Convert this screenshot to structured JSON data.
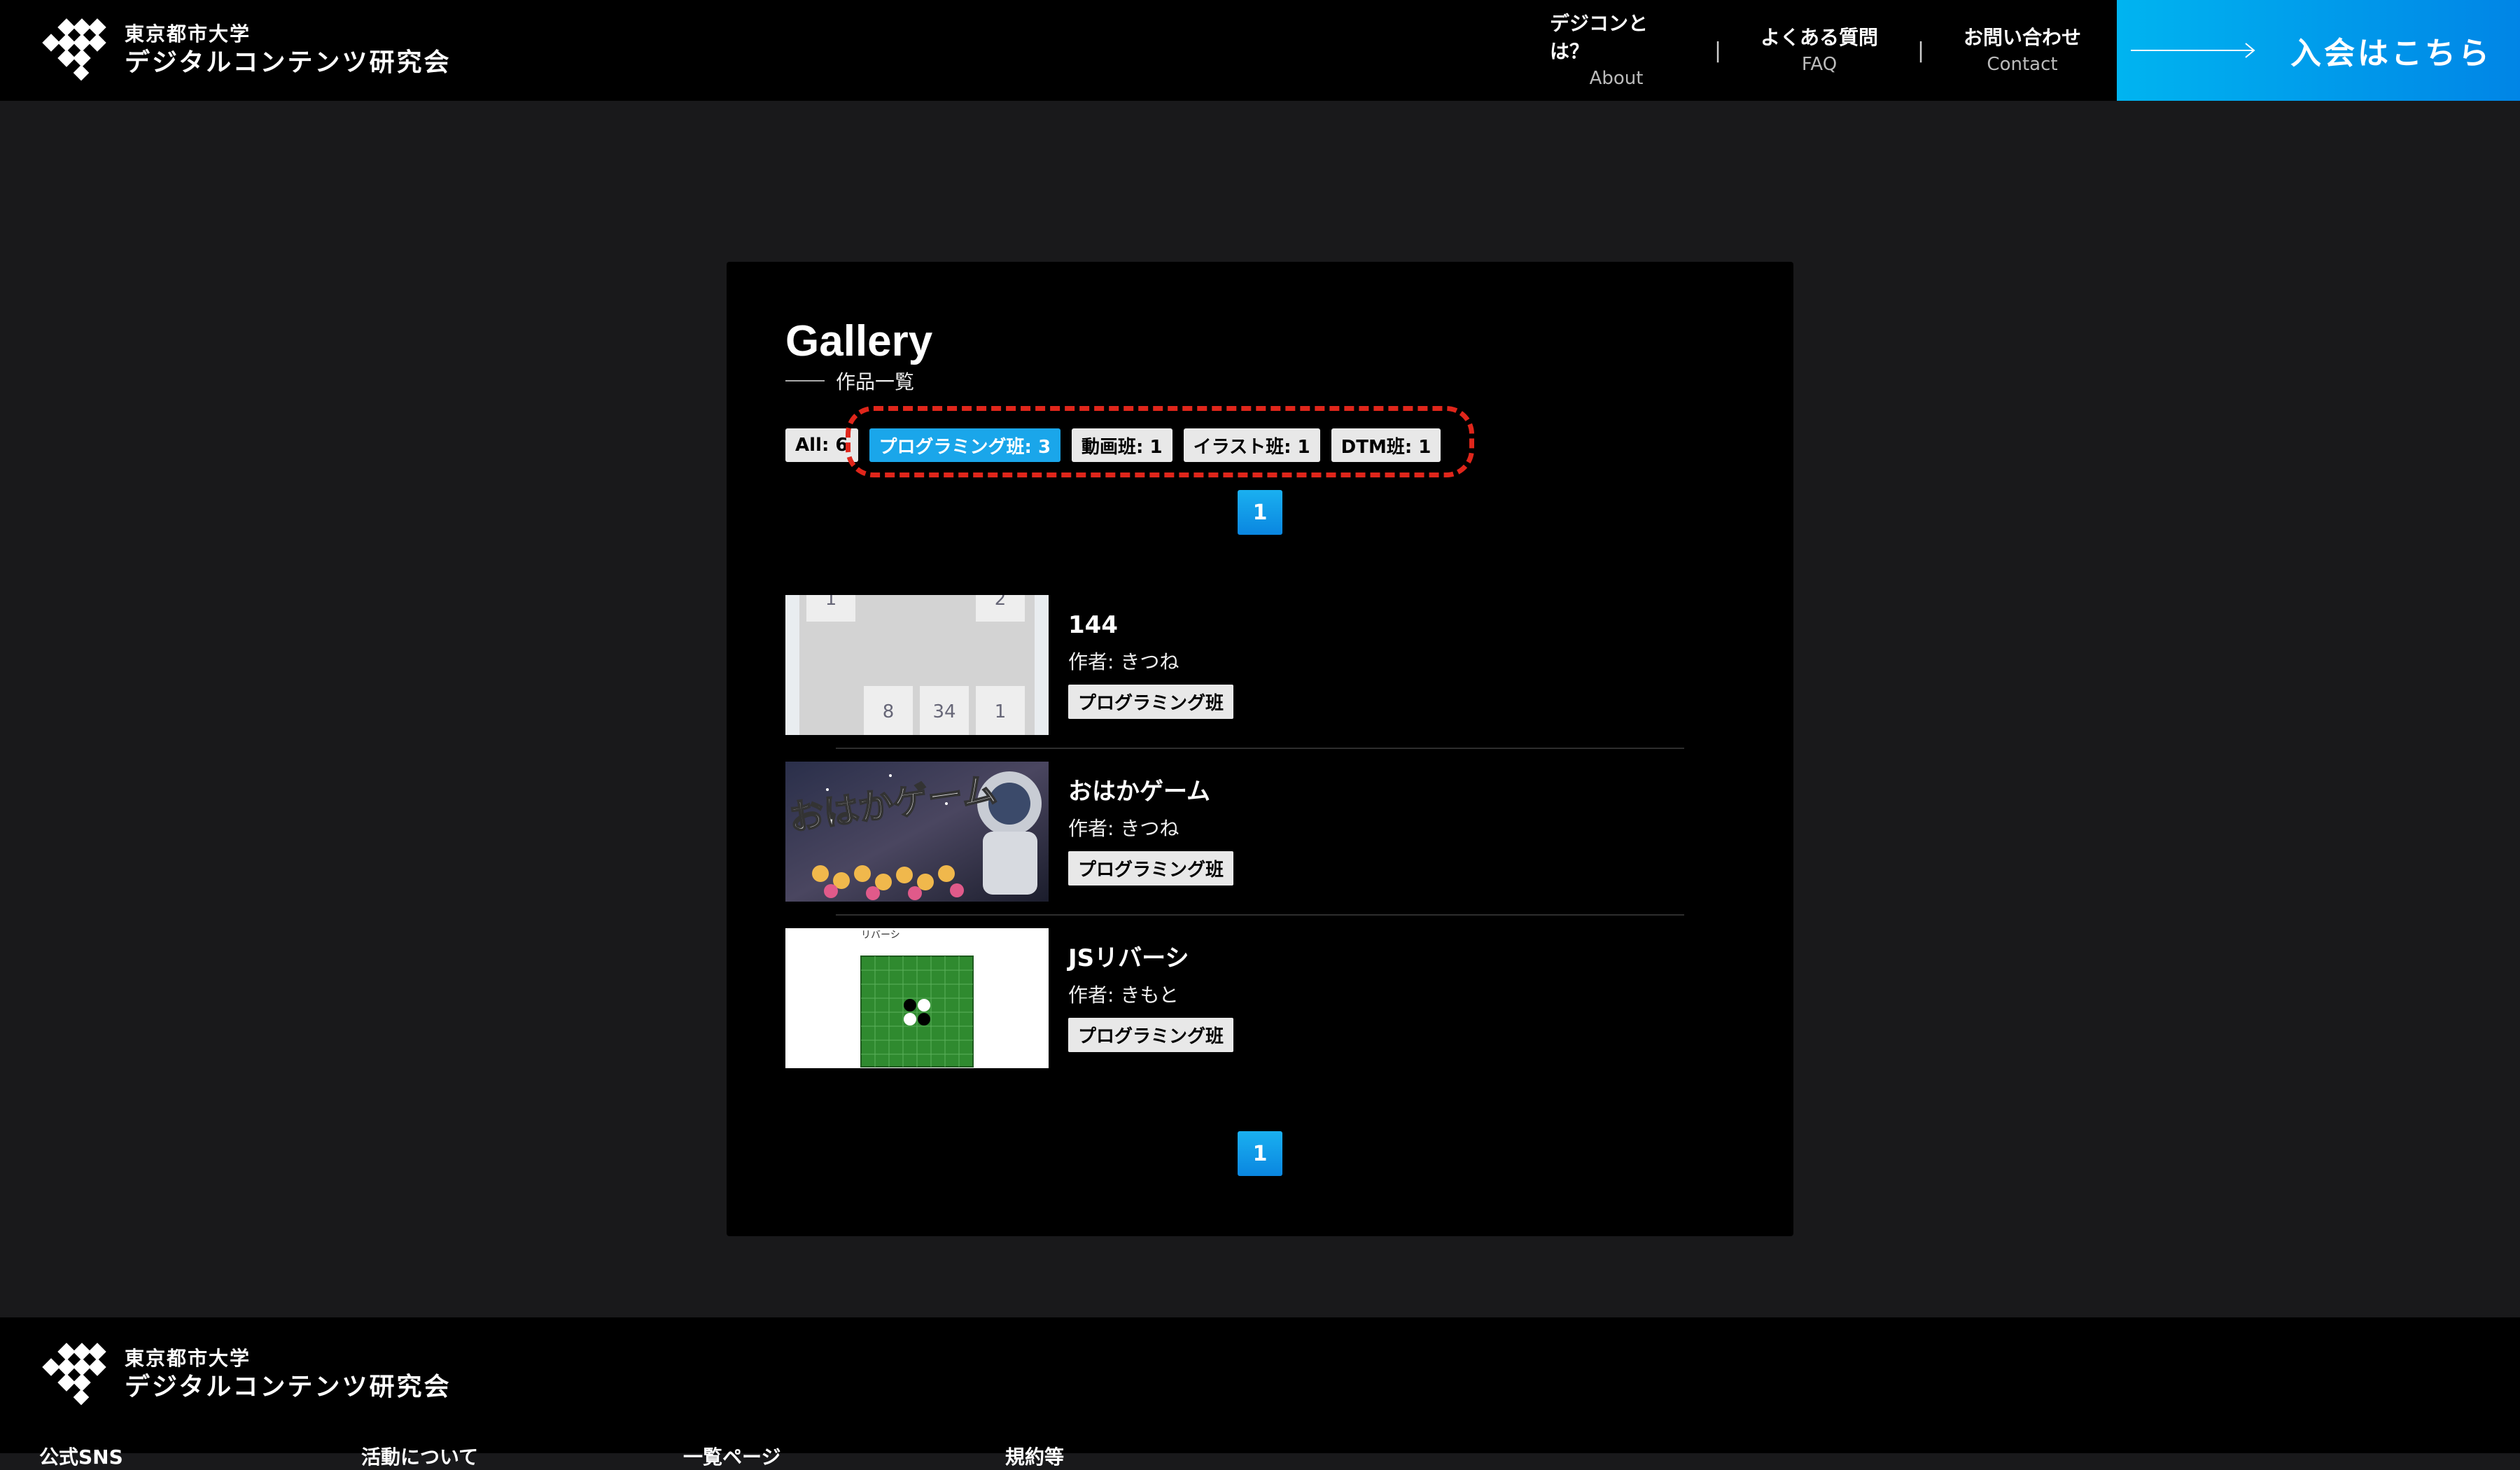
{
  "header": {
    "logo_line1": "東京都市大学",
    "logo_line2": "デジタルコンテンツ研究会",
    "nav": [
      {
        "label": "デジコンとは？",
        "sub": "About"
      },
      {
        "label": "よくある質問",
        "sub": "FAQ"
      },
      {
        "label": "お問い合わせ",
        "sub": "Contact"
      }
    ],
    "separator": "|",
    "join_label": "入会はこちら"
  },
  "gallery": {
    "title": "Gallery",
    "subtitle": "作品一覧",
    "filters": [
      {
        "label": "All: 6",
        "active": false
      },
      {
        "label": "プログラミング班: 3",
        "active": true
      },
      {
        "label": "動画班: 1",
        "active": false
      },
      {
        "label": "イラスト班: 1",
        "active": false
      },
      {
        "label": "DTM班: 1",
        "active": false
      }
    ],
    "page": "1",
    "items": [
      {
        "title": "144",
        "author": "作者: きつね",
        "tag": "プログラミング班",
        "thumb": {
          "tiles": [
            "1",
            "2",
            "8",
            "34",
            "1"
          ]
        }
      },
      {
        "title": "おはかゲーム",
        "author": "作者: きつね",
        "tag": "プログラミング班",
        "thumb": {
          "text": "おはかゲーム"
        }
      },
      {
        "title": "JSリバーシ",
        "author": "作者: きもと",
        "tag": "プログラミング班",
        "thumb": {
          "text": "リバーシ"
        }
      }
    ]
  },
  "footer": {
    "logo_line1": "東京都市大学",
    "logo_line2": "デジタルコンテンツ研究会",
    "links": [
      "公式SNS",
      "活動について",
      "一覧ページ",
      "規約等"
    ]
  },
  "colors": {
    "accent": "#1aa6ea",
    "highlight": "#e0261b",
    "background": "#19191b"
  }
}
